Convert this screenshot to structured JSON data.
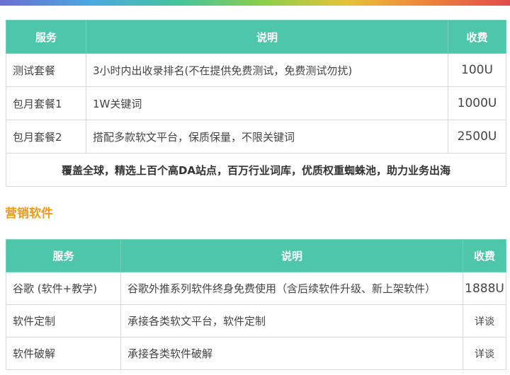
{
  "table_seo": {
    "headers": {
      "service": "服务",
      "description": "说明",
      "fee": "收费"
    },
    "rows": [
      {
        "service": "测试套餐",
        "description": "3小时内出收录排名(不在提供免费测试，免费测试勿扰)",
        "fee": "100U"
      },
      {
        "service": "包月套餐1",
        "description": "1W关键词",
        "fee": "1000U"
      },
      {
        "service": "包月套餐2",
        "description": "搭配多款软文平台，保质保量，不限关键词",
        "fee": "2500U"
      }
    ],
    "footer": "覆盖全球，精选上百个高DA站点，百万行业词库，优质权重蜘蛛池，助力业务出海"
  },
  "section_title": "营销软件",
  "table_software": {
    "headers": {
      "service": "服务",
      "description": "说明",
      "fee": "收费"
    },
    "rows": [
      {
        "service": "谷歌 (软件+教学)",
        "description": "谷歌外推系列软件终身免费使用（含后续软件升级、新上架软件）",
        "fee": "1888U"
      },
      {
        "service": "软件定制",
        "description": "承接各类软文平台，软件定制",
        "fee": "详谈"
      },
      {
        "service": "软件破解",
        "description": "承接各类软件破解",
        "fee": "详谈"
      }
    ]
  },
  "colors": {
    "header_bg": "#4dc6aa",
    "section_title": "#f29a1a"
  }
}
